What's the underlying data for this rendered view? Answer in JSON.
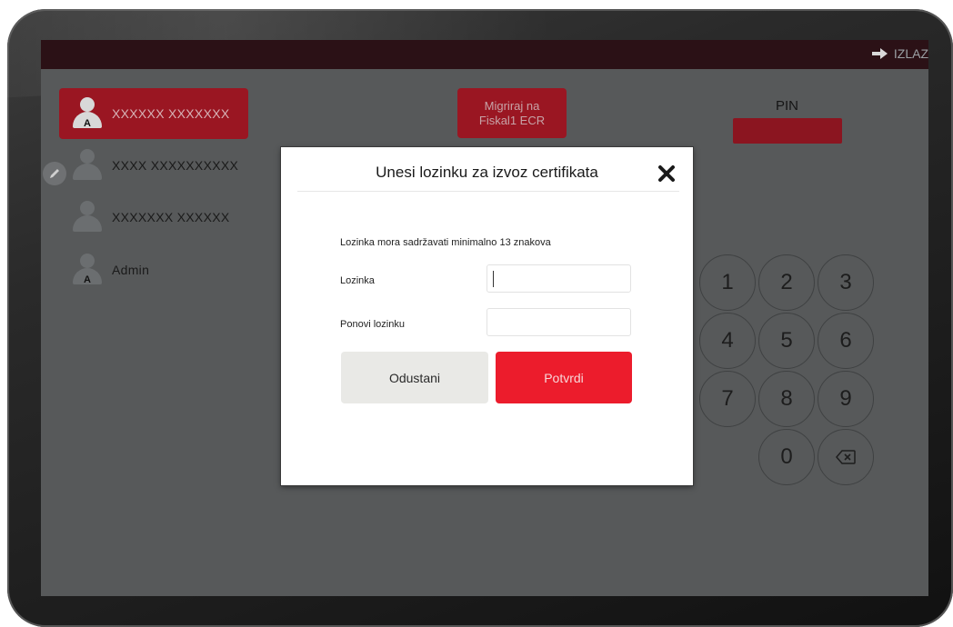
{
  "topbar": {
    "exit_label": "IZLAZ"
  },
  "users": [
    {
      "name": "XXXXXX XXXXXXX",
      "badge": "A",
      "active": true
    },
    {
      "name": "XXXX XXXXXXXXXX",
      "badge": "",
      "active": false
    },
    {
      "name": "XXXXXXX XXXXXX",
      "badge": "",
      "active": false
    },
    {
      "name": "Admin",
      "badge": "A",
      "active": false
    }
  ],
  "migrate": {
    "line1": "Migriraj na",
    "line2": "Fiskal1 ECR"
  },
  "pin": {
    "label": "PIN"
  },
  "keypad": {
    "keys": [
      "1",
      "2",
      "3",
      "4",
      "5",
      "6",
      "7",
      "8",
      "9",
      "0"
    ],
    "backspace_icon": "backspace-icon"
  },
  "modal": {
    "title": "Unesi lozinku za izvoz certifikata",
    "hint": "Lozinka mora sadržavati minimalno 13 znakova",
    "password_label": "Lozinka",
    "password_value": "",
    "repeat_label": "Ponovi lozinku",
    "repeat_value": "",
    "cancel_label": "Odustani",
    "confirm_label": "Potvrdi"
  },
  "colors": {
    "accent": "#ec1c2c",
    "brand_dark_red": "#9a1622",
    "screen_bg": "#57595a",
    "topbar": "#2b1116"
  }
}
